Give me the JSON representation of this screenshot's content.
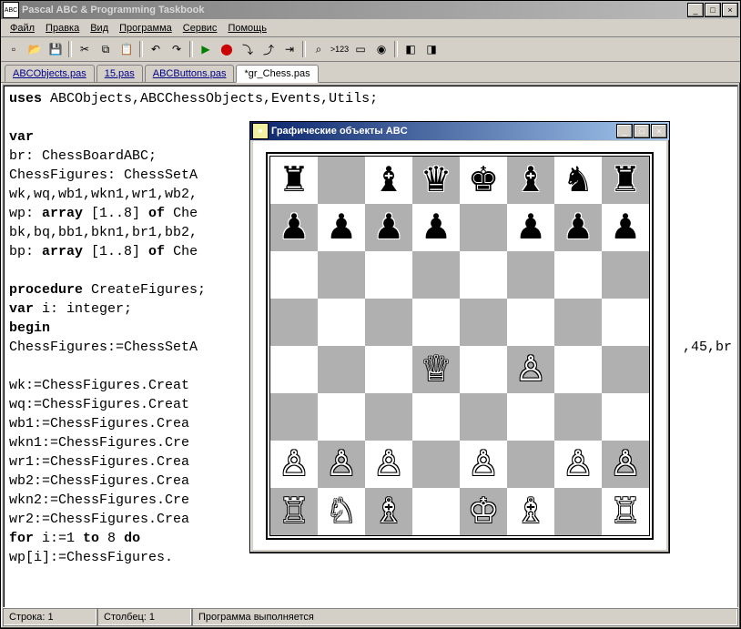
{
  "main_title": "Pascal ABC & Programming Taskbook",
  "menu": {
    "file": "Файл",
    "edit": "Правка",
    "view": "Вид",
    "program": "Программа",
    "service": "Сервис",
    "help": "Помощь"
  },
  "tabs": {
    "t0": "ABCObjects.pas",
    "t1": "15.pas",
    "t2": "ABCButtons.pas",
    "t3": "*gr_Chess.pas"
  },
  "code": {
    "l0a": "uses",
    "l0b": " ABCObjects,ABCChessObjects,Events,Utils;",
    "l1": "",
    "l2": "var",
    "l3": "  br: ChessBoardABC;",
    "l4": "  ChessFigures: ChessSetA",
    "l5": "  wk,wq,wb1,wkn1,wr1,wb2,",
    "l6a": "  wp: ",
    "l6b": "array",
    "l6c": " [1..8] ",
    "l6d": "of",
    "l6e": " Che",
    "l7": "  bk,bq,bb1,bkn1,br1,bb2,",
    "l8a": "  bp: ",
    "l8b": "array",
    "l8c": " [1..8] ",
    "l8d": "of",
    "l8e": " Che",
    "l9": "",
    "l10a": "procedure",
    "l10b": " CreateFigures;",
    "l11a": "var",
    "l11b": " i: integer;",
    "l12": "begin",
    "l13a": "  ChessFigures:=ChessSetA",
    "l13b": ",45,br",
    "l14": "",
    "l15": "  wk:=ChessFigures.Creat",
    "l16": "  wq:=ChessFigures.Creat",
    "l17": "  wb1:=ChessFigures.Crea",
    "l18": "  wkn1:=ChessFigures.Cre",
    "l19": "  wr1:=ChessFigures.Crea",
    "l20": "  wb2:=ChessFigures.Crea",
    "l21": "  wkn2:=ChessFigures.Cre",
    "l22": "  wr2:=ChessFigures.Crea",
    "l23a": "  ",
    "l23b": "for",
    "l23c": " i:=1 ",
    "l23d": "to",
    "l23e": " 8 ",
    "l23f": "do",
    "l24": "    wp[i]:=ChessFigures."
  },
  "status": {
    "line": "Строка: 1",
    "col": "Столбец: 1",
    "msg": "Программа выполняется"
  },
  "child_title": "Графические объекты ABC",
  "board": [
    [
      "br",
      "",
      "bb",
      "bq",
      "bk",
      "bb",
      "bn",
      "br"
    ],
    [
      "bp",
      "bp",
      "bp",
      "bp",
      "",
      "bp",
      "bp",
      "bp"
    ],
    [
      "",
      "",
      "",
      "",
      "",
      "",
      "",
      ""
    ],
    [
      "",
      "",
      "",
      "",
      "",
      "",
      "",
      ""
    ],
    [
      "",
      "",
      "",
      "wq",
      "",
      "wp",
      "",
      ""
    ],
    [
      "",
      "",
      "",
      "",
      "",
      "",
      "",
      ""
    ],
    [
      "wp",
      "wp",
      "wp",
      "",
      "wp",
      "",
      "wp",
      "wp"
    ],
    [
      "wr",
      "wn",
      "wb",
      "",
      "wk",
      "wb",
      "",
      "wr"
    ]
  ],
  "piece_glyphs": {
    "wk": "♔",
    "wq": "♕",
    "wr": "♖",
    "wb": "♗",
    "wn": "♘",
    "wp": "♙",
    "bk": "♚",
    "bq": "♛",
    "br": "♜",
    "bb": "♝",
    "bn": "♞",
    "bp": "♟"
  }
}
